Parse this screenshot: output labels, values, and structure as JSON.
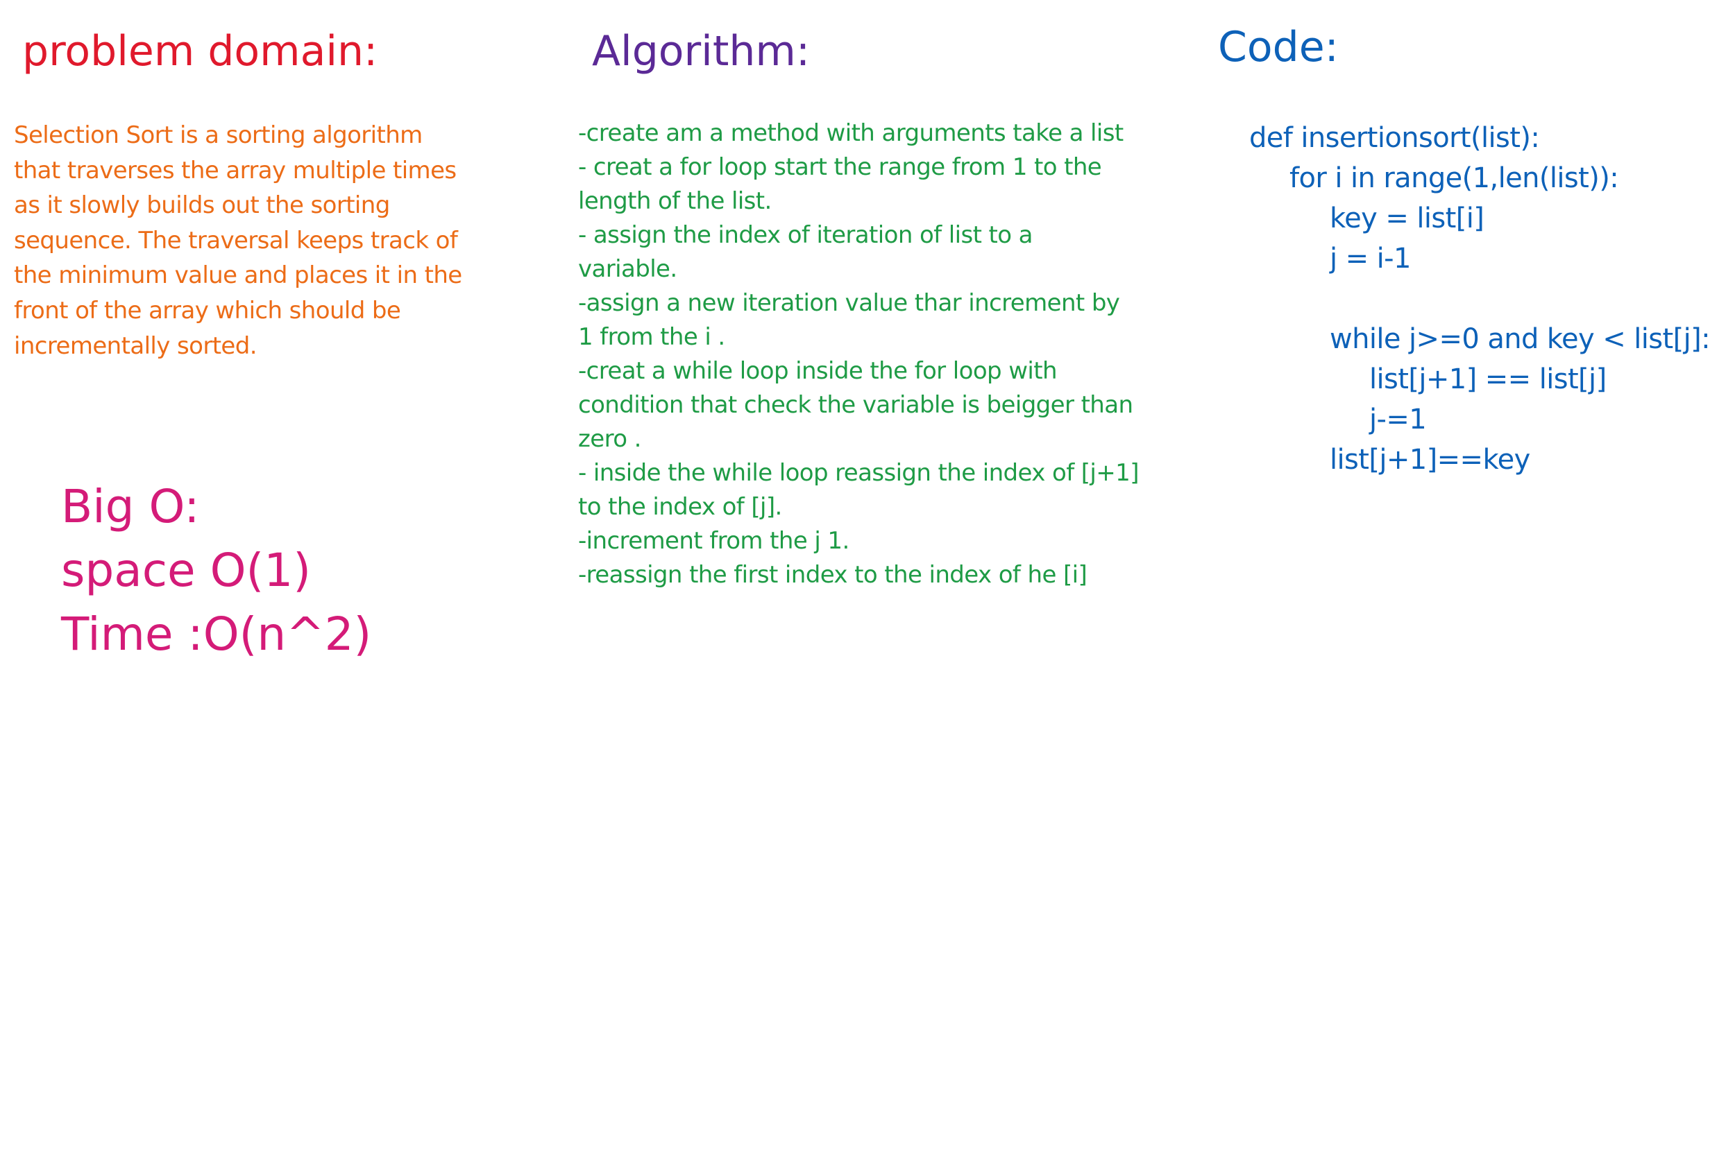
{
  "problem": {
    "heading": "problem domain:",
    "lines": [
      "Selection Sort is a sorting algorithm",
      "that traverses the array multiple times",
      "as it slowly builds out the sorting",
      "sequence. The traversal keeps track of",
      "the minimum value and places it in the",
      "front of the array which should be",
      "incrementally sorted."
    ]
  },
  "algorithm": {
    "heading": "Algorithm:",
    "lines": [
      "-create am a method with arguments take a list",
      "- creat a for loop start the range from 1 to the",
      "length of the list.",
      "- assign the index of iteration of list to a",
      "variable.",
      "-assign a new iteration value thar increment by",
      "1 from the i .",
      "-creat a while loop inside the for loop with",
      "condition that check the variable is beigger than",
      "zero .",
      "- inside the while loop reassign the index of [j+1]",
      "to the index of [j].",
      "-increment from the j 1.",
      "-reassign the first index to the index of he [i]"
    ]
  },
  "code": {
    "heading": "Code:",
    "lines": [
      "def insertionsort(list):",
      "for i in range(1,len(list)):",
      "key = list[i]",
      "j = i-1",
      "",
      "while j>=0 and key < list[j]:",
      "list[j+1] == list[j]",
      "j-=1",
      "list[j+1]==key"
    ]
  },
  "bigo": {
    "heading": "Big O:",
    "space": "space O(1)",
    "time": "Time :O(n^2)"
  }
}
